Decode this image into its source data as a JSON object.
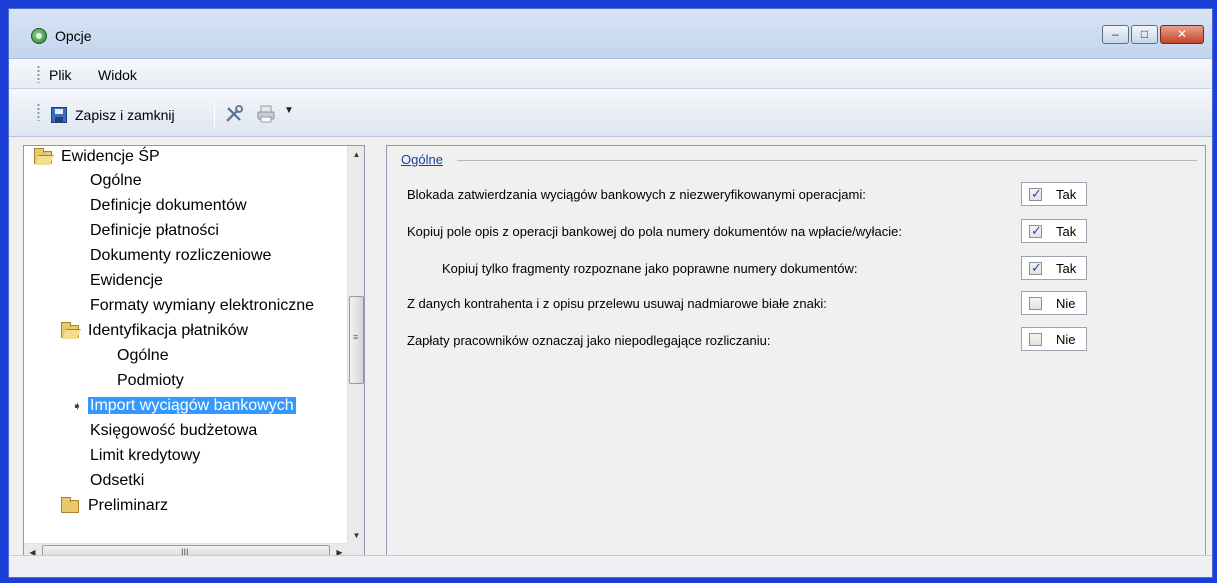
{
  "window": {
    "title": "Opcje",
    "controls": {
      "minimize": "–",
      "maximize": "□",
      "close": "✕"
    }
  },
  "menu": {
    "items": [
      {
        "label": "Plik",
        "accel": "P"
      },
      {
        "label": "Widok",
        "accel": "W"
      }
    ]
  },
  "toolbar": {
    "save_label": "Zapisz i zamknij",
    "icons": [
      "floppy-disk-icon",
      "tools-icon",
      "printer-icon",
      "chevron-down-icon"
    ]
  },
  "tree": {
    "items": [
      {
        "label": "Ewidencje ŚP",
        "level": 0,
        "icon": "folder-open-icon"
      },
      {
        "label": "Ogólne",
        "level": 1
      },
      {
        "label": "Definicje dokumentów",
        "level": 1
      },
      {
        "label": "Definicje płatności",
        "level": 1
      },
      {
        "label": "Dokumenty rozliczeniowe",
        "level": 1
      },
      {
        "label": "Ewidencje",
        "level": 1
      },
      {
        "label": "Formaty wymiany elektroniczne",
        "level": 1
      },
      {
        "label": "Identyfikacja płatników",
        "level": 1,
        "icon": "folder-open-icon"
      },
      {
        "label": "Ogólne",
        "level": 2
      },
      {
        "label": "Podmioty",
        "level": 2
      },
      {
        "label": "Import wyciągów bankowych",
        "level": 1,
        "selected": true
      },
      {
        "label": "Księgowość budżetowa",
        "level": 1
      },
      {
        "label": "Limit kredytowy",
        "level": 1
      },
      {
        "label": "Odsetki",
        "level": 1
      },
      {
        "label": "Preliminarz",
        "level": 0,
        "icon": "folder-icon"
      }
    ],
    "scroll_grip": "≡",
    "hscroll_grip": "III"
  },
  "settings": {
    "group_title": "Ogólne",
    "options": [
      {
        "label": "Blokada zatwierdzania wyciągów bankowych z niezweryfikowanymi operacjami:",
        "checked": true,
        "value": "Tak"
      },
      {
        "label": "Kopiuj pole opis z operacji bankowej do pola numery dokumentów na wpłacie/wyłacie:",
        "checked": true,
        "value": "Tak"
      },
      {
        "label": "Kopiuj tylko fragmenty rozpoznane jako poprawne numery dokumentów:",
        "checked": true,
        "value": "Tak"
      },
      {
        "label": "Z danych kontrahenta i z opisu przelewu usuwaj nadmiarowe białe znaki:",
        "checked": false,
        "value": "Nie"
      },
      {
        "label": "Zapłaty pracowników oznaczaj jako niepodlegające rozliczaniu:",
        "checked": false,
        "value": "Nie"
      }
    ]
  },
  "colors": {
    "desktop": "#1a3fd6",
    "selection": "#3399ff",
    "group_title": "#1a3ea8",
    "close_button": "#c5432a"
  }
}
